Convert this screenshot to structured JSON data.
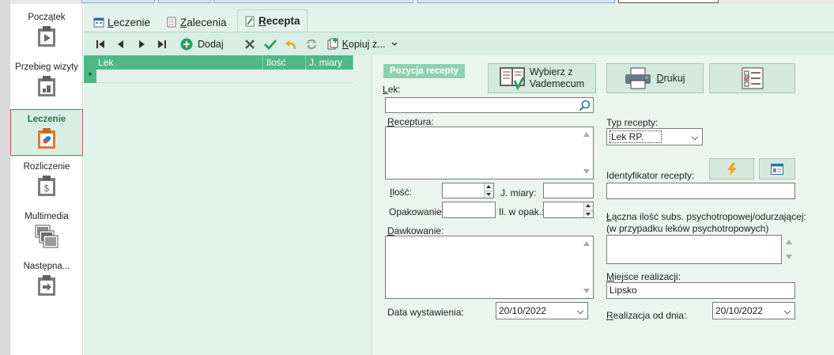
{
  "sidebar": {
    "items": [
      {
        "label": "Początek",
        "icon": "clipboard-play-icon",
        "active": false
      },
      {
        "label": "Przebieg wizyty",
        "icon": "clipboard-steps-icon",
        "active": false
      },
      {
        "label": "Leczenie",
        "icon": "clipboard-pill-icon",
        "active": true
      },
      {
        "label": "Rozliczenie",
        "icon": "clipboard-dollar-icon",
        "active": false
      },
      {
        "label": "Multimedia",
        "icon": "images-icon",
        "active": false
      },
      {
        "label": "Następna...",
        "icon": "clipboard-next-icon",
        "active": false
      }
    ]
  },
  "tabs": [
    {
      "label": "Leczenie",
      "underline": "L",
      "rest": "eczenie",
      "icon": "calendar-icon",
      "active": false
    },
    {
      "label": "Zalecenia",
      "underline": "Z",
      "rest": "alecenia",
      "icon": "document-icon",
      "active": false
    },
    {
      "label": "Recepta",
      "underline": "R",
      "rest": "ecepta",
      "icon": "prescription-icon",
      "active": true
    }
  ],
  "toolbar": {
    "add_label": "Dodaj",
    "copy_label": "Kopiuj z...",
    "copy_underline": "K",
    "copy_rest": "opiuj z..."
  },
  "grid": {
    "columns": [
      "Lek",
      "Ilość",
      "J. miary"
    ],
    "new_row_marker": "*"
  },
  "form": {
    "section_title": "Pozycja recepty",
    "vademecum_button": {
      "line1": "Wybierz z",
      "line2": "Vademecum"
    },
    "print_button": {
      "underline": "D",
      "rest": "rukuj"
    },
    "lek_label": {
      "underline": "L",
      "rest": "ek:"
    },
    "lek_value": "",
    "receptura_label": {
      "underline": "R",
      "rest": "eceptura:"
    },
    "ilosc_label": {
      "underline": "I",
      "rest": "lość:"
    },
    "ilosc_value": "",
    "jmiary_label": "J. miary:",
    "jmiary_value": "",
    "opakowanie_label": "Opakowanie",
    "opakowanie_value": "",
    "il_w_opak_label": "Il. w opak.:",
    "il_w_opak_value": "",
    "dawkowanie_label": {
      "underline": "D",
      "rest": "awkowanie:"
    },
    "data_wystawienia_label": "Data wystawienia:",
    "data_wystawienia_value": "20/10/2022",
    "typ_recepty_label": "Typ recepty:",
    "typ_recepty_value": "Lek RP.",
    "identyfikator_label": "Identyfikator recepty:",
    "identyfikator_value": "",
    "laczna_label_line1": {
      "underline": "Ł",
      "rest": "ączna ilość subs. psychotropowej/odurzającej:"
    },
    "laczna_label_line2": "(w przypadku leków psychotropowych)",
    "miejsce_label": {
      "underline": "M",
      "rest": "iejsce realizacji:"
    },
    "miejsce_value": "Lipsko",
    "realizacja_label": {
      "underline": "R",
      "rest": "ealizacja od dnia:"
    },
    "realizacja_value": "20/10/2022"
  },
  "colors": {
    "accent_green": "#4fb884",
    "panel_bg": "#e4f2ec",
    "active_sidebar_border": "#d45050"
  }
}
